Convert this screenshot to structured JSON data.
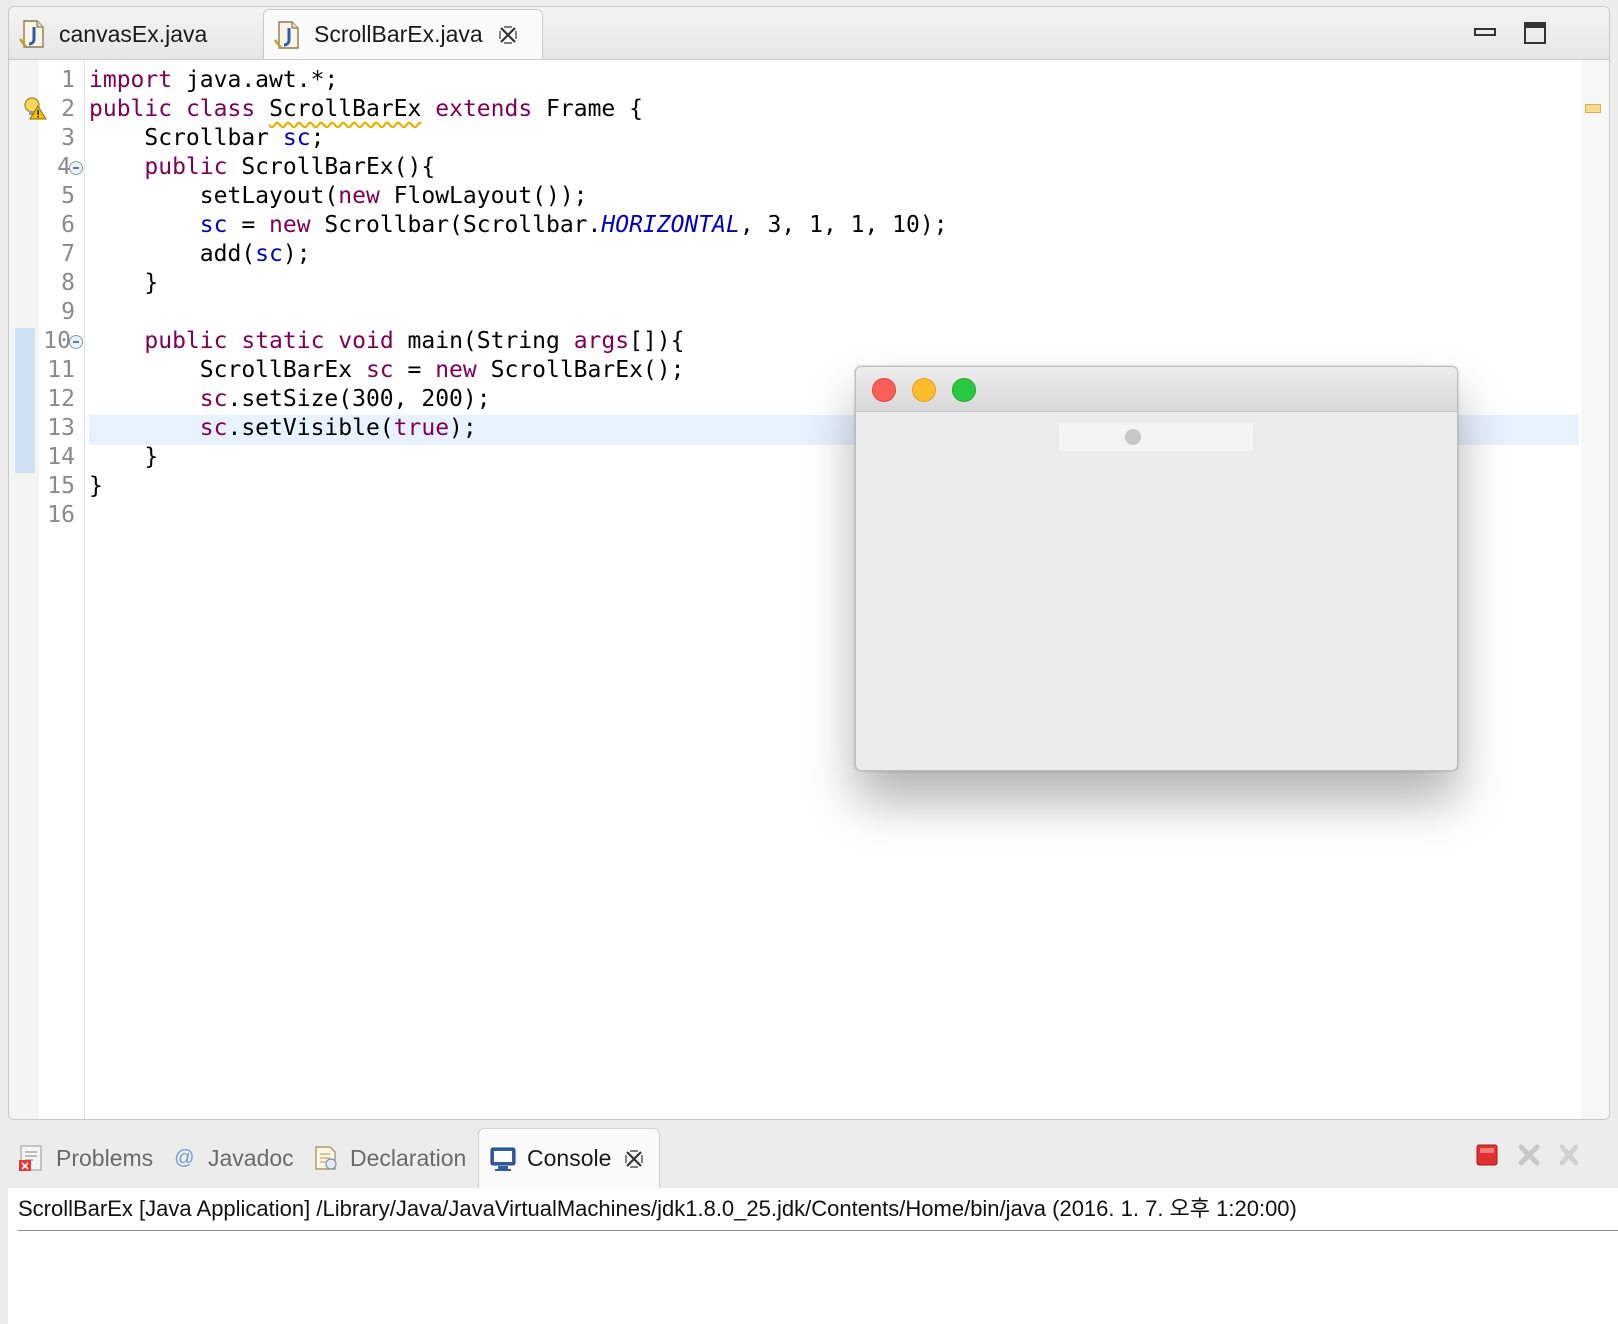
{
  "editor": {
    "tabs": [
      {
        "label": "canvasEx.java",
        "icon": "java-file-icon",
        "active": false
      },
      {
        "label": "ScrollBarEx.java",
        "icon": "java-file-icon",
        "active": true
      }
    ],
    "window_controls": [
      "minimize-icon",
      "maximize-icon"
    ],
    "line_numbers": [
      "1",
      "2",
      "3",
      "4",
      "5",
      "6",
      "7",
      "8",
      "9",
      "10",
      "11",
      "12",
      "13",
      "14",
      "15",
      "16"
    ],
    "code": {
      "l1": {
        "kw_import": "import",
        "rest": " java.awt.*;"
      },
      "l2": {
        "kw_public": "public",
        "kw_class": "class",
        "class_name": "ScrollBarEx",
        "kw_extends": "extends",
        "rest": " Frame {"
      },
      "l3": {
        "type": "Scrollbar",
        "field": "sc",
        "semi": ";"
      },
      "l4": {
        "kw_public": "public",
        "rest": " ScrollBarEx(){"
      },
      "l5": {
        "call": "setLayout(",
        "kw_new": "new",
        "rest": " FlowLayout());"
      },
      "l6": {
        "field": "sc",
        "eq": " = ",
        "kw_new": "new",
        "mid": " Scrollbar(Scrollbar.",
        "const": "HORIZONTAL",
        "rest": ", 3, 1, 1, 10);"
      },
      "l7": {
        "call": "add(",
        "field": "sc",
        "rest": ");"
      },
      "l8": "}",
      "l10": {
        "kw_public": "public",
        "kw_static": "static",
        "kw_void": "void",
        "mid": " main(String ",
        "param": "args",
        "rest": "[]){"
      },
      "l11": {
        "type": "ScrollBarEx ",
        "var": "sc",
        "eq": " = ",
        "kw_new": "new",
        "rest": " ScrollBarEx();"
      },
      "l12": {
        "var": "sc",
        "rest": ".setSize(300, 200);"
      },
      "l13": {
        "var": "sc",
        "mid": ".setVisible(",
        "kw_true": "true",
        "rest": ");"
      },
      "l14": "}",
      "l15": "}"
    },
    "warning_icon": "warning-lightbulb-icon"
  },
  "awt_window": {
    "traffic_lights": [
      "close",
      "minimize",
      "zoom"
    ],
    "scrollbar_value": 3,
    "scrollbar_min": 1,
    "scrollbar_max": 10
  },
  "bottom_panel": {
    "tabs": [
      {
        "label": "Problems",
        "icon": "problems-icon"
      },
      {
        "label": "Javadoc",
        "icon": "javadoc-icon"
      },
      {
        "label": "Declaration",
        "icon": "declaration-icon"
      },
      {
        "label": "Console",
        "icon": "console-icon",
        "active": true
      }
    ],
    "console_header": "ScrollBarEx [Java Application] /Library/Java/JavaVirtualMachines/jdk1.8.0_25.jdk/Contents/Home/bin/java (2016. 1. 7. 오후 1:20:00)"
  },
  "colors": {
    "keyword": "#7f0055",
    "field": "#0000c0",
    "current_line": "#e8f2fe",
    "terminate_red": "#e03030"
  }
}
